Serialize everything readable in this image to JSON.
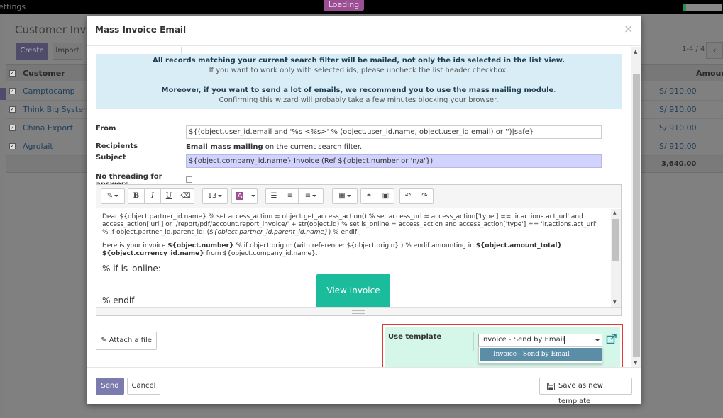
{
  "topbar": {
    "settings_text": "ettings",
    "loading_text": "Loading"
  },
  "background": {
    "title": "Customer Invoic",
    "create_label": "Create",
    "import_label": "Import",
    "pager": "1-4 / 4",
    "pager_prev": "‹",
    "columns": [
      "Customer",
      "Amoun"
    ],
    "rows": [
      {
        "customer": "Camptocamp",
        "amount": "S/ 910.00"
      },
      {
        "customer": "Think Big Systems",
        "amount": "S/ 910.00"
      },
      {
        "customer": "China Export",
        "amount": "S/ 910.00"
      },
      {
        "customer": "Agrolait",
        "amount": "S/ 910.00"
      }
    ],
    "total": "3,640.00"
  },
  "modal": {
    "title": "Mass Invoice Email",
    "close": "×",
    "alert": {
      "line1": "All records matching your current search filter will be mailed, not only the ids selected in the list view.",
      "line2": "If you want to work only with selected ids, please uncheck the list header checkbox.",
      "line3": "Moreover, if you want to send a lot of emails, we recommend you to use the mass mailing module",
      "line3_end": ".",
      "line4": "Confirming this wizard will probably take a few minutes blocking your browser."
    },
    "from": {
      "label": "From",
      "value": "${(object.user_id.email and '%s <%s>' % (object.user_id.name, object.user_id.email) or '')|safe}"
    },
    "recipients": {
      "label": "Recipients",
      "bold": "Email mass mailing",
      "rest": " on the current search filter."
    },
    "subject": {
      "label": "Subject",
      "value": "${object.company_id.name} Invoice (Ref ${object.number or 'n/a'})"
    },
    "no_threading": {
      "label_1": "No threading for",
      "label_2": "answers",
      "checked": false
    },
    "toolbar": {
      "style": "✎",
      "bold": "B",
      "italic": "I",
      "underline": "U",
      "eraser": "⌫",
      "font_size": "13",
      "color": "A",
      "ul": "☰",
      "ol": "≡",
      "align": "≡",
      "table": "▦",
      "link": "⚭",
      "file": "▣",
      "undo": "↶",
      "redo": "↷"
    },
    "body": {
      "p1a": "Dear ${object.partner_id.name} % set access_action = object.get_access_action() % set access_url = access_action['type'] == 'ir.actions.act_url' and",
      "p1b": "access_action['url'] or '/report/pdf/account.report_invoice/' + str(object.id) % set is_online = access_action and access_action['type'] == 'ir.actions.act_url'",
      "p1c_pre": "% if object.partner_id.parent_id: (",
      "p1c_it": "${object.partner_id.parent_id.name}",
      "p1c_post": ") % endif ,",
      "p2_pre": "Here is your invoice ",
      "p2_b1": "${object.number}",
      "p2_mid": " % if object.origin: (with reference: ${object.origin} ) % endif amounting in ",
      "p2_b2": "${object.amount_total}",
      "p2_b3": "${object.currency_id.name}",
      "p2_end": " from ${object.company_id.name}.",
      "if_online": "% if is_online:",
      "endif": "% endif",
      "view_invoice": "View Invoice"
    },
    "attach_label": "Attach a file",
    "template": {
      "label": "Use template",
      "value": "Invoice - Send by Email",
      "option": "Invoice - Send by Email"
    },
    "footer": {
      "send": "Send",
      "cancel": "Cancel",
      "save_template": "Save as new template"
    }
  },
  "colors": {
    "accent": "#7c7bad",
    "alert_bg": "#d9edf7",
    "template_bg": "#d4f7e9",
    "highlight_border": "#e53935",
    "view_button": "#1abc9c"
  }
}
